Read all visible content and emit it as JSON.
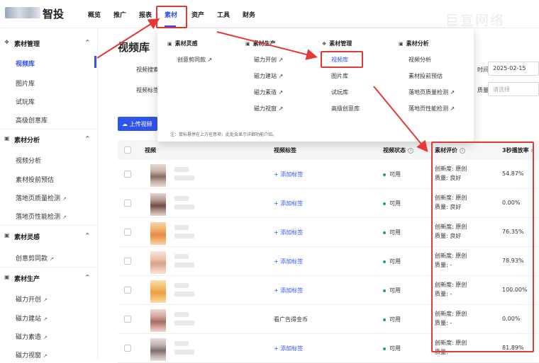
{
  "app": {
    "logo_text": "智投",
    "watermark": "巨宣网络"
  },
  "nav": [
    "概览",
    "推广",
    "报表",
    "素材",
    "资产",
    "工具",
    "财务"
  ],
  "sidebar": {
    "groups": [
      {
        "icon": "❖",
        "label": "素材管理",
        "chevron": "^",
        "items": [
          {
            "label": "视频库",
            "active": true
          },
          {
            "label": "图片库"
          },
          {
            "label": "试玩库"
          },
          {
            "label": "高级创意库"
          }
        ]
      },
      {
        "icon": "▣",
        "label": "素材分析",
        "chevron": "^",
        "items": [
          {
            "label": "视频分析"
          },
          {
            "label": "素材投前预估"
          },
          {
            "label": "落地页质量检测",
            "ext": "↗"
          },
          {
            "label": "落地页性能检测",
            "ext": "↗"
          }
        ]
      },
      {
        "icon": "▣",
        "label": "素材灵感",
        "chevron": "^",
        "items": [
          {
            "label": "创意剪同款",
            "ext": "↗"
          }
        ]
      },
      {
        "icon": "▣",
        "label": "素材生产",
        "chevron": "^",
        "items": [
          {
            "label": "磁力开创",
            "ext": "↗"
          },
          {
            "label": "磁力建站",
            "ext": "↗"
          },
          {
            "label": "磁力素造",
            "ext": "↗"
          },
          {
            "label": "磁力视窗",
            "ext": "↗"
          }
        ]
      }
    ]
  },
  "page": {
    "title": "视频库"
  },
  "filters": {
    "label1": "视频搜索",
    "label2": "视频标签",
    "date_label": "时间",
    "date_value": "2025-02-15",
    "quality_label": "质量",
    "quality_placeholder": "请选择"
  },
  "upload_label": "上传视频",
  "table": {
    "headers": {
      "video": "视频",
      "tags": "视频标签",
      "status": "视频状态",
      "eval": "素材评价",
      "rate": "3秒播放率"
    },
    "rows": [
      {
        "tag": "+ 添加标签",
        "status": "可用",
        "novelty_label": "创新度:",
        "novelty": "原创",
        "quality_label": "质量:",
        "quality": "良好",
        "rate": "54.87%"
      },
      {
        "tag": "+ 添加标签",
        "status": "可用",
        "novelty_label": "创新度:",
        "novelty": "原创",
        "quality_label": "质量:",
        "quality": "良好",
        "rate": "0.00%"
      },
      {
        "tag": "+ 添加标签",
        "status": "可用",
        "novelty_label": "创新度:",
        "novelty": "原创",
        "quality_label": "质量:",
        "quality": "良好",
        "rate": "76.35%"
      },
      {
        "tag": "+ 添加标签",
        "status": "可用",
        "novelty_label": "创新度:",
        "novelty": "原创",
        "quality_label": "质量:",
        "quality": "-",
        "rate": "78.93%"
      },
      {
        "tag": "+ 添加标签",
        "status": "可用",
        "novelty_label": "创新度:",
        "novelty": "原创",
        "quality_label": "质量:",
        "quality": "-",
        "rate": "100.00%"
      },
      {
        "tag": "看广告得金币",
        "status": "可用",
        "novelty_label": "创新度:",
        "novelty": "原创",
        "quality_label": "质量:",
        "quality": "-",
        "rate": "0.00%"
      },
      {
        "tag": "+ 添加标签",
        "status": "可用",
        "novelty_label": "创新度:",
        "novelty": "原创",
        "quality_label": "质量:",
        "quality": "-",
        "rate": "81.89%"
      }
    ]
  },
  "dropdown": {
    "columns": [
      {
        "icon": "▣",
        "header": "素材灵感",
        "items": [
          "创意剪同款 ↗"
        ]
      },
      {
        "icon": "▣",
        "header": "素材生产",
        "items": [
          "磁力开创 ↗",
          "磁力建站 ↗",
          "磁力素造 ↗",
          "磁力视窗 ↗"
        ]
      },
      {
        "icon": "❖",
        "header": "素材管理",
        "items": [
          "视频库",
          "图片库",
          "试玩库",
          "高级创意库"
        ]
      },
      {
        "icon": "▣",
        "header": "素材分析",
        "items": [
          "视频分析",
          "素材投前预估",
          "落地页质量检测 ↗",
          "落地页性能检测 ↗"
        ]
      }
    ],
    "note": "注：鼠标悬停在上方任意项，此处会显示详细功能介绍。"
  },
  "colors": {
    "accent": "#2f54eb",
    "annotation": "#e53935",
    "status_ok": "#21a366"
  },
  "icons": {
    "upload": "cloud-upload-icon",
    "info": "info-icon",
    "external": "external-link-icon"
  }
}
